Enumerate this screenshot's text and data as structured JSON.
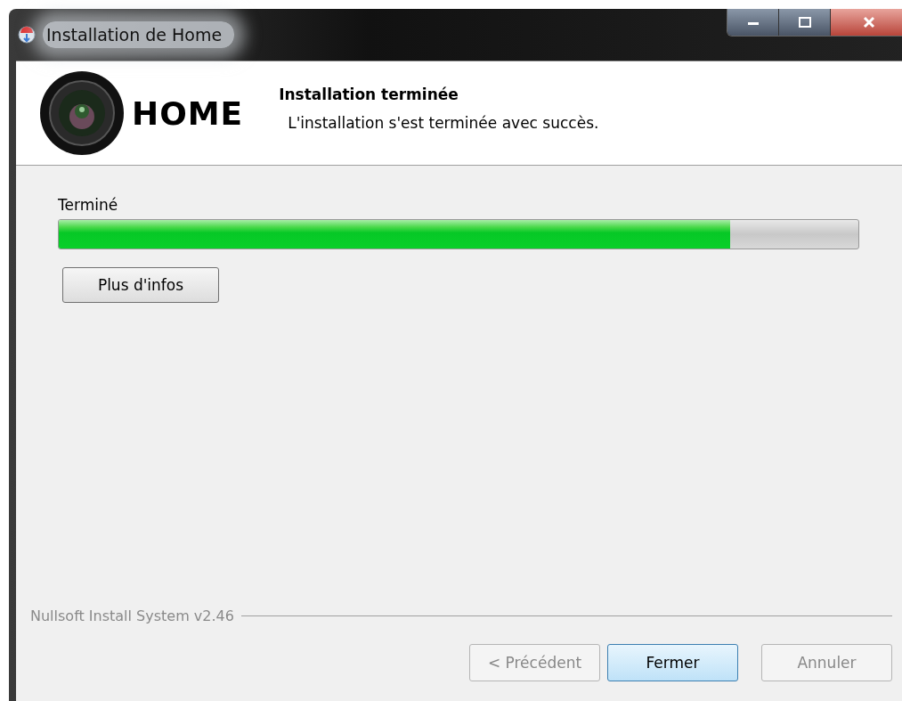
{
  "window": {
    "title": "Installation de Home"
  },
  "header": {
    "logo_text": "HOME",
    "title": "Installation terminée",
    "subtitle": "L'installation s'est terminée avec succès."
  },
  "progress": {
    "label": "Terminé",
    "level": 0.84
  },
  "details_button": "Plus d'infos",
  "branding": "Nullsoft Install System v2.46",
  "buttons": [
    {
      "label": "< Précédent",
      "disabled": true,
      "default": false
    },
    {
      "label": "Fermer",
      "disabled": false,
      "default": true
    },
    {
      "label": "Annuler",
      "disabled": true,
      "default": false
    }
  ]
}
